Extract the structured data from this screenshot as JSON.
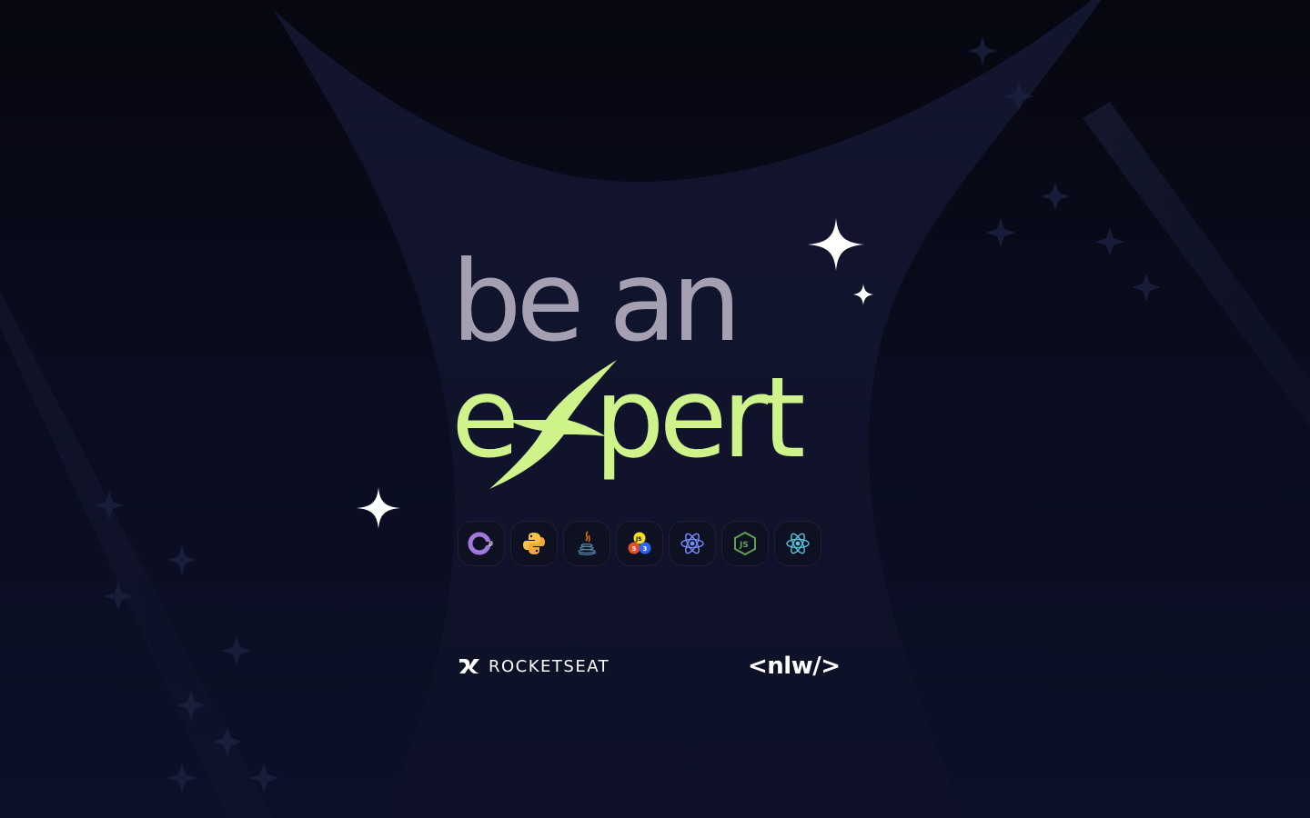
{
  "headline": {
    "line1": "be an",
    "line2_prefix": "e",
    "line2_suffix": "pert"
  },
  "colors": {
    "headline_line1": "#a49fb1",
    "headline_accent": "#cdf38a",
    "background": "#0a0b1a",
    "sparkle": "#ffffff"
  },
  "technologies": [
    {
      "icon": "csharp-icon"
    },
    {
      "icon": "python-icon"
    },
    {
      "icon": "java-icon"
    },
    {
      "icon": "html-css-js-icon"
    },
    {
      "icon": "react-icon"
    },
    {
      "icon": "nodejs-icon"
    },
    {
      "icon": "react-native-icon"
    }
  ],
  "brands": {
    "rocketseat": "ROCKETSEAT",
    "nlw": "<nlw/>"
  }
}
